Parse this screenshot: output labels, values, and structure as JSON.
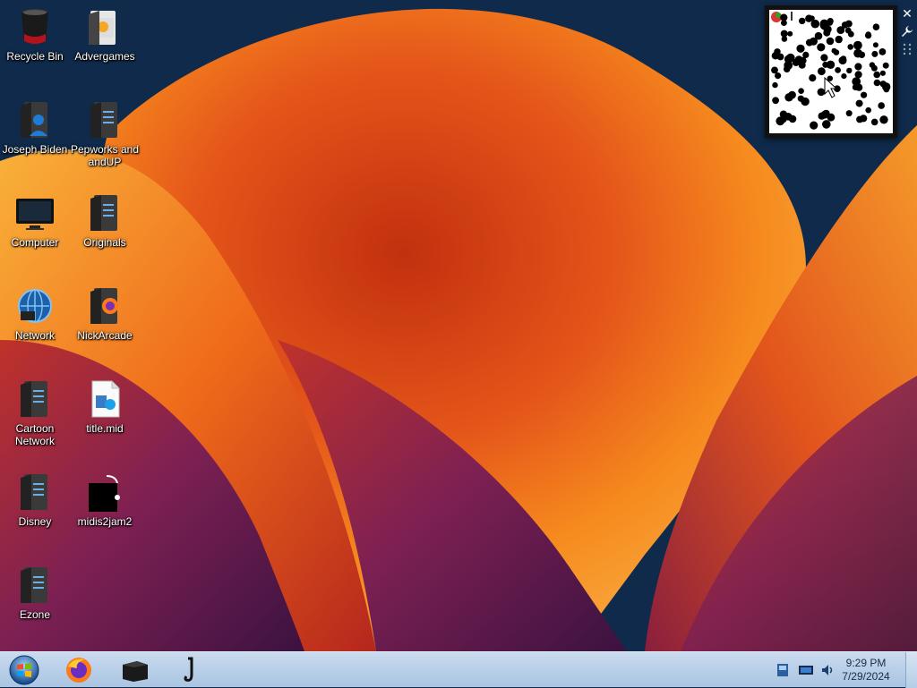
{
  "desktop": {
    "icons": [
      {
        "label": "Recycle Bin",
        "icon": "recycle-bin-icon"
      },
      {
        "label": "Advergames",
        "icon": "folder-icon"
      },
      {
        "label": "Joseph Biden",
        "icon": "user-folder-icon"
      },
      {
        "label": "Pepworks and andUP",
        "icon": "folder-icon"
      },
      {
        "label": "Computer",
        "icon": "computer-monitor-icon"
      },
      {
        "label": "Originals",
        "icon": "folder-icon"
      },
      {
        "label": "Network",
        "icon": "network-globe-icon"
      },
      {
        "label": "NickArcade",
        "icon": "firefox-folder-icon"
      },
      {
        "label": "Cartoon Network",
        "icon": "folder-icon"
      },
      {
        "label": "title.mid",
        "icon": "midi-file-icon"
      },
      {
        "label": "Disney",
        "icon": "folder-icon"
      },
      {
        "label": "midis2jam2",
        "icon": "midis2jam2-icon"
      },
      {
        "label": "Ezone",
        "icon": "folder-icon"
      }
    ]
  },
  "gadget": {
    "close_icon": "close-icon",
    "options_icon": "wrench-icon",
    "drag_icon": "grip-icon"
  },
  "taskbar": {
    "start_icon": "windows-start-orb-icon",
    "pinned": [
      {
        "name": "firefox",
        "icon": "firefox-icon"
      },
      {
        "name": "terminal",
        "icon": "black-box-icon"
      },
      {
        "name": "saxophone",
        "icon": "saxophone-icon"
      }
    ],
    "tray": [
      {
        "icon": "network-adapter-icon"
      },
      {
        "icon": "display-icon"
      },
      {
        "icon": "speaker-icon"
      }
    ],
    "clock": {
      "time": "9:29 PM",
      "date": "7/29/2024"
    }
  },
  "colors": {
    "taskbar": "#b8cfe8",
    "wallpaper_orange": "#f47a16",
    "wallpaper_purple": "#6a1e4f",
    "wallpaper_navy": "#0f2a4a"
  }
}
